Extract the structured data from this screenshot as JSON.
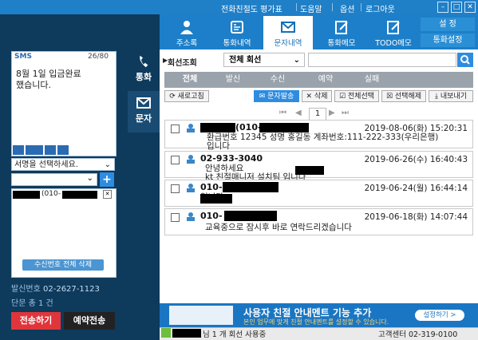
{
  "header": {
    "links": [
      "전화친절도 평가표",
      "도움말",
      "옵션",
      "로그아웃"
    ],
    "window_buttons": [
      "–",
      "□",
      "✕"
    ]
  },
  "top_tabs": [
    {
      "label": "주소록",
      "icon": "person-icon"
    },
    {
      "label": "통화내역",
      "icon": "phone-icon"
    },
    {
      "label": "문자내역",
      "icon": "envelope-icon",
      "active": true
    },
    {
      "label": "통화메모",
      "icon": "memo-icon"
    },
    {
      "label": "TODO메모",
      "icon": "todo-icon"
    }
  ],
  "settings": {
    "set_label": "설  정",
    "call_set_label": "통화설정"
  },
  "side_nav": [
    {
      "label": "통화",
      "icon": "phone-icon"
    },
    {
      "label": "문자",
      "icon": "envelope-icon",
      "active": true
    }
  ],
  "compose": {
    "sms_label": "SMS",
    "counter": "26/80",
    "body": "8월 1일 입금완료\n했습니다.",
    "signature_placeholder": "서명을 선택하세요.",
    "recipient_prefix": "(010-",
    "delete_all_label": "수신번호 전체 삭제",
    "sender_label": "발신번호",
    "sender_number": "02-2627-1123",
    "count_label": "단문 총 1 건",
    "send_label": "전송하기",
    "reserve_label": "예약전송"
  },
  "search": {
    "conv_label": "회선조회",
    "conv_value": "전체 회선"
  },
  "filter_tabs": [
    "전체",
    "발신",
    "수신",
    "예약",
    "실패"
  ],
  "actions": {
    "refresh": "새로고침",
    "send_sms": "문자발송",
    "delete": "삭제",
    "select_all": "전체선택",
    "deselect": "선택해제",
    "export": "내보내기"
  },
  "pager": {
    "page": "1"
  },
  "messages": [
    {
      "number": "(010-",
      "date": "2019-08-06(화) 15:20:31",
      "text": "환급번호 12345 성명 홍길동 계좌번호:111-222-333(우리은행)\n입니다"
    },
    {
      "number": "02-933-3040",
      "date": "2019-06-26(수) 16:40:43",
      "text": "안녕하세요\nkt 친절매니저 설치팀        입니다"
    },
    {
      "number": "010-",
      "date": "2019-06-24(월) 16:44:14",
      "text": "        입니다"
    },
    {
      "number": "010-",
      "date": "2019-06-18(화) 14:07:44",
      "text": "교육중으로 잠시후 바로 연락드리겠습니다"
    }
  ],
  "banner": {
    "title": "사용자 친절 안내멘트 기능 추가",
    "subtitle": "본인 업무에 맞게 친절 안내멘트를 설정할 수 있습니다.",
    "button": "설정하기 >"
  },
  "status": {
    "text": "님  1 개 회선 사용중",
    "cs": "고객센터 02-319-0100"
  },
  "colors": {
    "accent": "#1f7fc7",
    "send": "#e0353b",
    "dark_bg": "#0e3a5c"
  }
}
